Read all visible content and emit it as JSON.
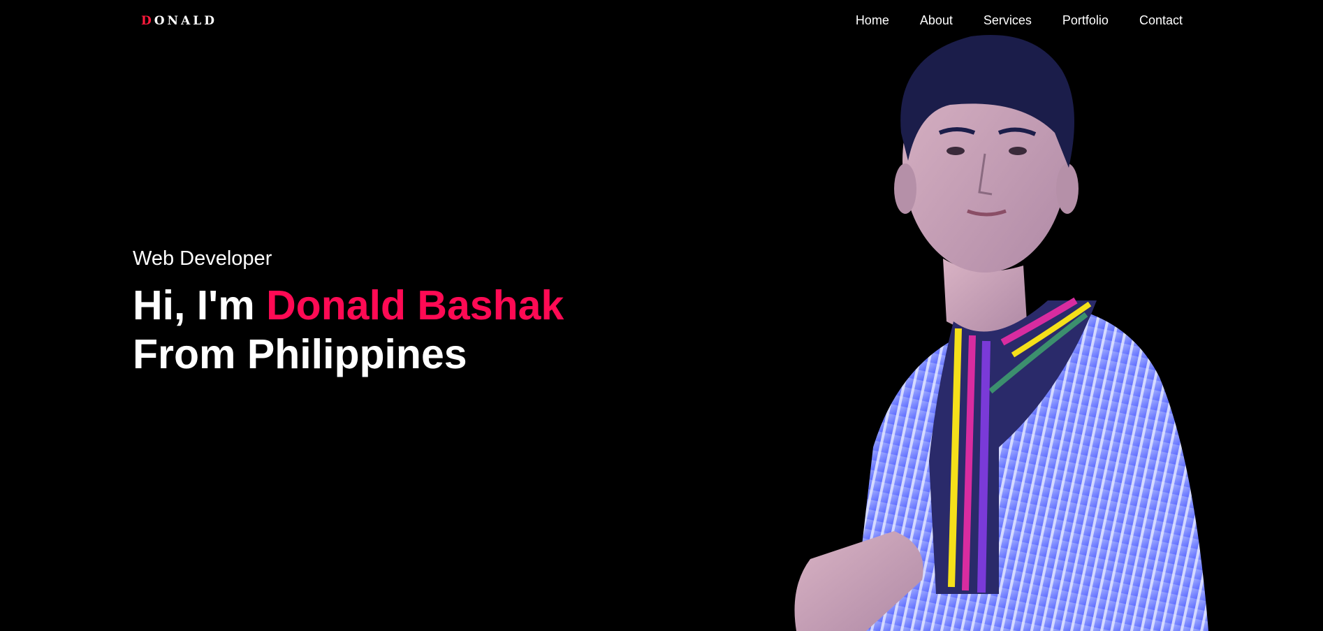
{
  "header": {
    "logo_first": "D",
    "logo_rest": "ONALD",
    "nav": [
      {
        "label": "Home"
      },
      {
        "label": "About"
      },
      {
        "label": "Services"
      },
      {
        "label": "Portfolio"
      },
      {
        "label": "Contact"
      }
    ]
  },
  "hero": {
    "subtitle": "Web Developer",
    "greeting": "Hi, I'm ",
    "name": "Donald Bashak",
    "from_line": "From Philippines"
  },
  "colors": {
    "background": "#000000",
    "accent": "#ff0a54",
    "logo_accent": "#ff1a3c",
    "text": "#ffffff"
  }
}
